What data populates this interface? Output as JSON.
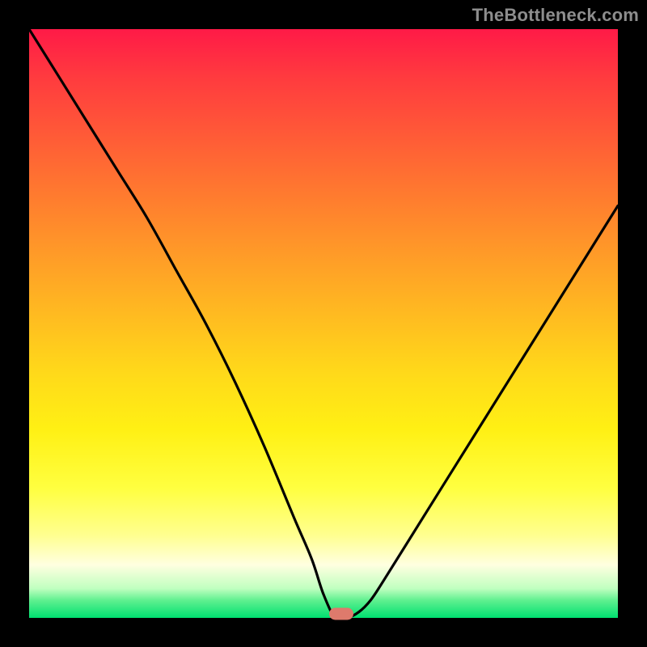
{
  "watermark": "TheBottleneck.com",
  "chart_data": {
    "type": "line",
    "title": "",
    "xlabel": "",
    "ylabel": "",
    "xlim": [
      0,
      100
    ],
    "ylim": [
      0,
      100
    ],
    "grid": false,
    "legend": false,
    "series": [
      {
        "name": "bottleneck-curve",
        "x": [
          0,
          5,
          10,
          15,
          20,
          25,
          30,
          35,
          40,
          45,
          48,
          50,
          52,
          54,
          56,
          58,
          60,
          65,
          70,
          75,
          80,
          85,
          90,
          95,
          100
        ],
        "values": [
          100,
          92,
          84,
          76,
          68,
          59,
          50,
          40,
          29,
          17,
          10,
          4,
          0,
          0,
          1,
          3,
          6,
          14,
          22,
          30,
          38,
          46,
          54,
          62,
          70
        ]
      }
    ],
    "marker": {
      "x": 53,
      "y": 0
    },
    "background_gradient": {
      "type": "vertical",
      "stops": [
        {
          "pos": 0,
          "color": "#ff1a47"
        },
        {
          "pos": 50,
          "color": "#ffcc1e"
        },
        {
          "pos": 80,
          "color": "#ffff60"
        },
        {
          "pos": 100,
          "color": "#00e070"
        }
      ]
    },
    "frame_color": "#000000"
  }
}
